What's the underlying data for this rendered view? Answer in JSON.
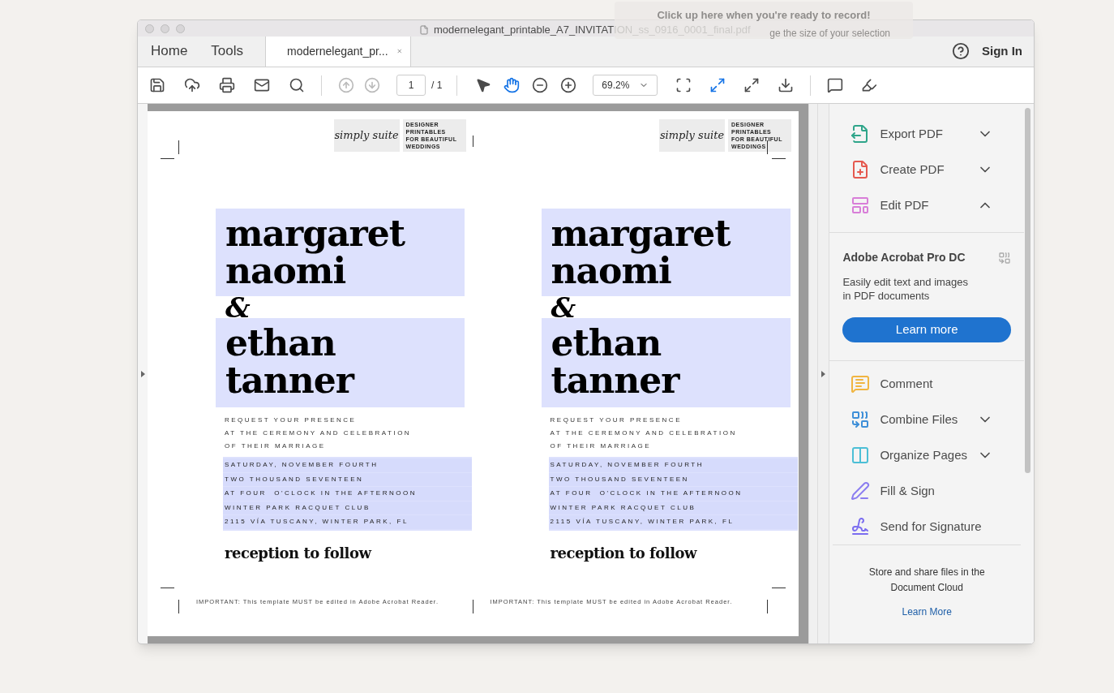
{
  "recorder_hint": {
    "title": "Click up here when you're ready to record!",
    "subtitle": "ge the size of your selection"
  },
  "window": {
    "title": "modernelegant_printable_A7_INVITATION_ss_0916_0001_final.pdf"
  },
  "nav": [
    {
      "label": "Home",
      "kind": "nav"
    },
    {
      "label": "Tools",
      "kind": "nav"
    },
    {
      "label": "modernelegant_pr...",
      "kind": "doc",
      "selected": true
    }
  ],
  "sign_in": "Sign In",
  "toolbar": {
    "page_number": "1",
    "page_total": "/ 1",
    "zoom": "69.2%"
  },
  "invitations": [
    {
      "logo": "simply suite",
      "tagline": [
        "DESIGNER",
        "PRINTABLES",
        "FOR BEAUTIFUL",
        "WEDDINGS"
      ],
      "bride": [
        "margaret",
        "naomi"
      ],
      "ampersand": "&",
      "groom": [
        "ethan",
        "tanner"
      ],
      "request": [
        "REQUEST YOUR PRESENCE",
        "AT THE CEREMONY AND CELEBRATION",
        "OF THEIR MARRIAGE"
      ],
      "details": [
        "SATURDAY, NOVEMBER FOURTH",
        "TWO THOUSAND SEVENTEEN",
        "AT FOUR  O'CLOCK IN THE AFTERNOON",
        "WINTER PARK RACQUET CLUB",
        "2115 VÍA TUSCANY, WINTER PARK, FL"
      ],
      "reception": "reception to follow",
      "note": "IMPORTANT: This template MUST be edited in Adobe Acrobat Reader."
    },
    {
      "logo": "simply suite",
      "tagline": [
        "DESIGNER",
        "PRINTABLES",
        "FOR BEAUTIFUL",
        "WEDDINGS"
      ],
      "bride": [
        "margaret",
        "naomi"
      ],
      "ampersand": "&",
      "groom": [
        "ethan",
        "tanner"
      ],
      "request": [
        "REQUEST YOUR PRESENCE",
        "AT THE CEREMONY AND CELEBRATION",
        "OF THEIR MARRIAGE"
      ],
      "details": [
        "SATURDAY, NOVEMBER FOURTH",
        "TWO THOUSAND SEVENTEEN",
        "AT FOUR  O'CLOCK IN THE AFTERNOON",
        "WINTER PARK RACQUET CLUB",
        "2115 VÍA TUSCANY, WINTER PARK, FL"
      ],
      "reception": "reception to follow",
      "note": "IMPORTANT: This template MUST be edited in Adobe Acrobat Reader."
    }
  ],
  "tools_top": [
    {
      "label": "Export PDF",
      "kind": "menu",
      "expanded": false
    },
    {
      "label": "Create PDF",
      "kind": "menu",
      "expanded": false
    },
    {
      "label": "Edit PDF",
      "kind": "menu",
      "expanded": true
    }
  ],
  "promo": {
    "title": "Adobe Acrobat Pro DC",
    "text": "Easily edit text and images in PDF documents",
    "button": "Learn more"
  },
  "tools_bottom": [
    {
      "label": "Comment",
      "kind": "link"
    },
    {
      "label": "Combine Files",
      "kind": "menu",
      "expanded": false
    },
    {
      "label": "Organize Pages",
      "kind": "menu",
      "expanded": false
    },
    {
      "label": "Fill & Sign",
      "kind": "link"
    },
    {
      "label": "Send for Signature",
      "kind": "link"
    }
  ],
  "cloud": {
    "text": "Store and share files in the Document Cloud",
    "link": "Learn More"
  }
}
